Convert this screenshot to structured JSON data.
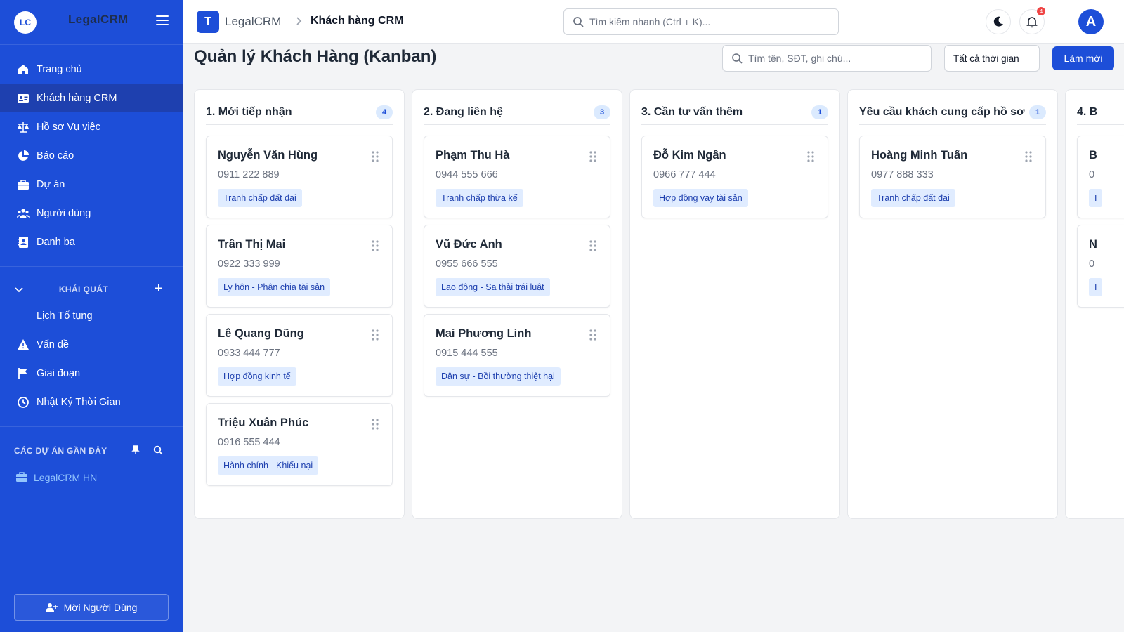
{
  "sidebar": {
    "logo": "LC",
    "brand": "LegalCRM",
    "nav": [
      {
        "label": "Trang chủ",
        "icon": "home-icon"
      },
      {
        "label": "Khách hàng CRM",
        "icon": "id-card-icon",
        "active": true
      },
      {
        "label": "Hồ sơ Vụ việc",
        "icon": "scale-icon"
      },
      {
        "label": "Báo cáo",
        "icon": "pie-chart-icon"
      },
      {
        "label": "Dự án",
        "icon": "briefcase-icon"
      },
      {
        "label": "Người dùng",
        "icon": "users-icon"
      },
      {
        "label": "Danh bạ",
        "icon": "contact-book-icon"
      }
    ],
    "section": {
      "title": "KHÁI QUÁT",
      "items": [
        {
          "label": "Lịch Tố tụng",
          "icon": ""
        },
        {
          "label": "Vấn đề",
          "icon": "warning-icon"
        },
        {
          "label": "Giai đoạn",
          "icon": "flag-icon"
        },
        {
          "label": "Nhật Ký Thời Gian",
          "icon": "clock-icon"
        }
      ]
    },
    "recent": {
      "title": "CÁC DỰ ÁN GẦN ĐÂY",
      "items": [
        {
          "label": "LegalCRM HN",
          "icon": "briefcase-icon"
        }
      ]
    },
    "invite_label": "Mời Người Dùng"
  },
  "topbar": {
    "logo_letter": "T",
    "app_name": "LegalCRM",
    "breadcrumb": "Khách hàng CRM",
    "search_placeholder": "Tìm kiếm nhanh (Ctrl + K)...",
    "notification_count": "4",
    "avatar_letter": "A"
  },
  "page": {
    "title": "Quản lý Khách Hàng (Kanban)",
    "filter_placeholder": "Tìm tên, SĐT, ghi chú...",
    "time_filter": "Tất cả thời gian",
    "refresh_label": "Làm mới"
  },
  "columns": [
    {
      "title": "1. Mới tiếp nhận",
      "count": "4",
      "cards": [
        {
          "name": "Nguyễn Văn Hùng",
          "phone": "0911 222 889",
          "tag": "Tranh chấp đất đai"
        },
        {
          "name": "Trần Thị Mai",
          "phone": "0922 333 999",
          "tag": "Ly hôn - Phân chia tài sản"
        },
        {
          "name": "Lê Quang Dũng",
          "phone": "0933 444 777",
          "tag": "Hợp đồng kinh tế"
        },
        {
          "name": "Triệu Xuân Phúc",
          "phone": "0916 555 444",
          "tag": "Hành chính - Khiếu nại"
        }
      ]
    },
    {
      "title": "2. Đang liên hệ",
      "count": "3",
      "cards": [
        {
          "name": "Phạm Thu Hà",
          "phone": "0944 555 666",
          "tag": "Tranh chấp thừa kế"
        },
        {
          "name": "Vũ Đức Anh",
          "phone": "0955 666 555",
          "tag": "Lao động - Sa thải trái luật"
        },
        {
          "name": "Mai Phương Linh",
          "phone": "0915 444 555",
          "tag": "Dân sự - Bồi thường thiệt hại"
        }
      ]
    },
    {
      "title": "3. Cần tư vấn thêm",
      "count": "1",
      "cards": [
        {
          "name": "Đỗ Kim Ngân",
          "phone": "0966 777 444",
          "tag": "Hợp đồng vay tài sản"
        }
      ]
    },
    {
      "title": "Yêu cầu khách cung cấp hồ sơ",
      "count": "1",
      "cards": [
        {
          "name": "Hoàng Minh Tuấn",
          "phone": "0977 888 333",
          "tag": "Tranh chấp đất đai"
        }
      ]
    },
    {
      "title": "4. B",
      "count": "",
      "cards": [
        {
          "name": "B",
          "phone": "0",
          "tag": "I"
        },
        {
          "name": "N",
          "phone": "0",
          "tag": "I"
        }
      ]
    }
  ]
}
